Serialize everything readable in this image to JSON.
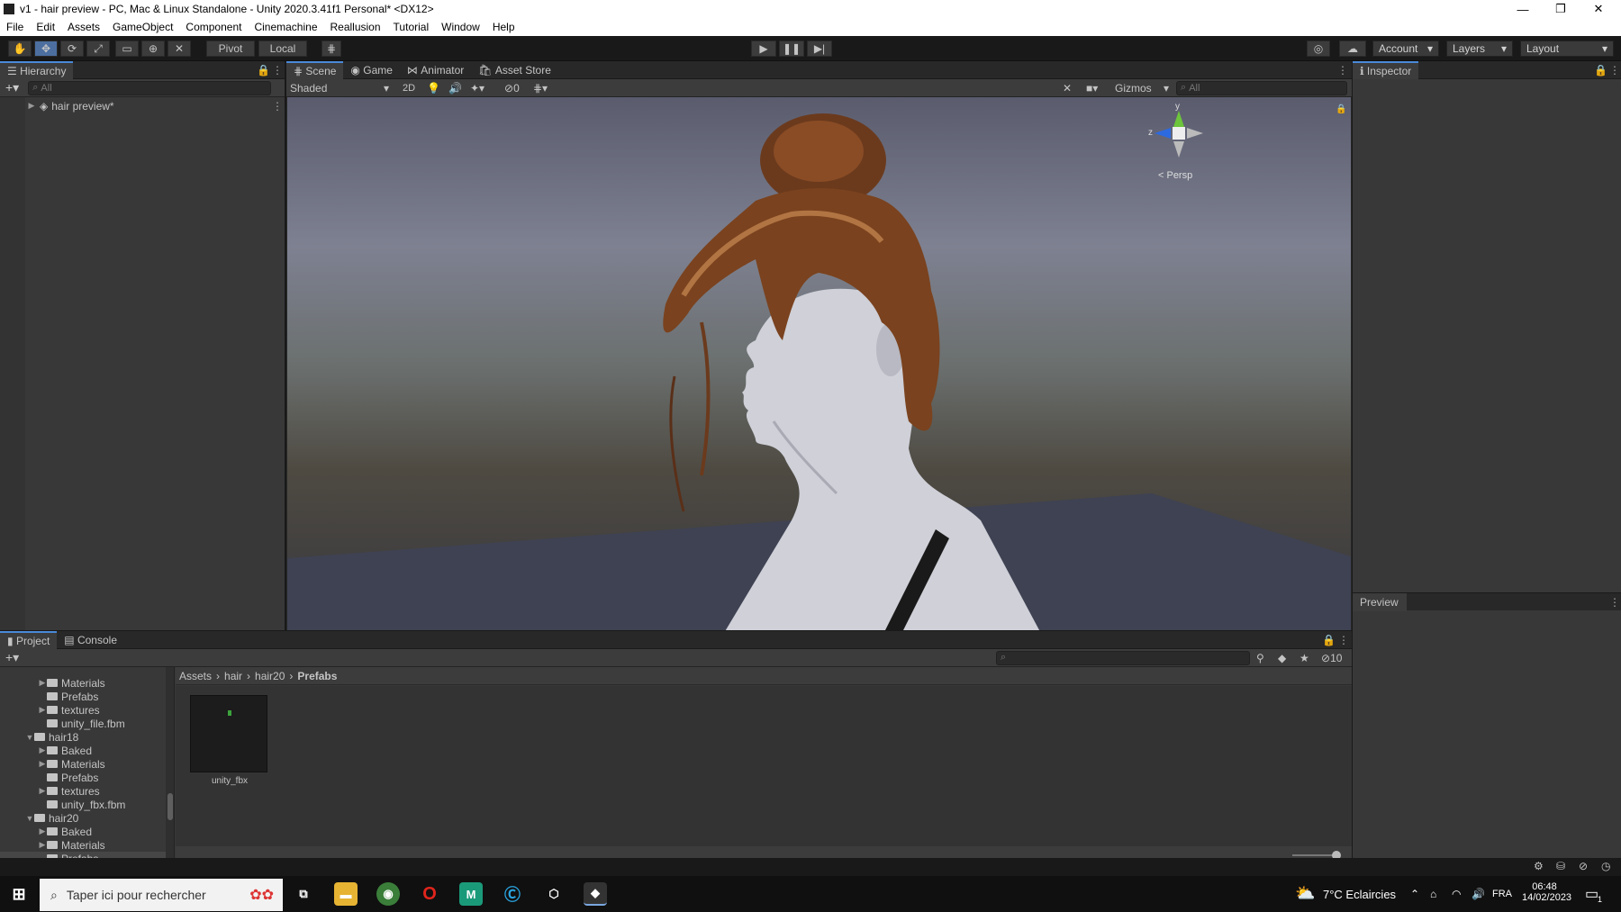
{
  "window": {
    "title": "v1 - hair preview - PC, Mac & Linux Standalone - Unity 2020.3.41f1 Personal* <DX12>"
  },
  "menu": [
    "File",
    "Edit",
    "Assets",
    "GameObject",
    "Component",
    "Cinemachine",
    "Reallusion",
    "Tutorial",
    "Window",
    "Help"
  ],
  "toolbar": {
    "pivot": "Pivot",
    "local": "Local",
    "account": "Account",
    "layers": "Layers",
    "layout": "Layout"
  },
  "hierarchy": {
    "title": "Hierarchy",
    "search_placeholder": "All",
    "scene_item": "hair preview*"
  },
  "scene_tabs": [
    "Scene",
    "Game",
    "Animator",
    "Asset Store"
  ],
  "scene_bar": {
    "shading": "Shaded",
    "mode2d": "2D",
    "hidden_count": "0",
    "gizmos": "Gizmos",
    "search_placeholder": "All"
  },
  "gizmo": {
    "y": "y",
    "z": "z",
    "persp": "< Persp"
  },
  "inspector": {
    "title": "Inspector",
    "preview": "Preview"
  },
  "project": {
    "tabs": [
      "Project",
      "Console"
    ],
    "hidden_count": "10",
    "breadcrumb": [
      "Assets",
      "hair",
      "hair20",
      "Prefabs"
    ],
    "tree": [
      {
        "label": "Materials",
        "arrow": "▶",
        "icon": true
      },
      {
        "label": "Prefabs",
        "arrow": "",
        "icon": true
      },
      {
        "label": "textures",
        "arrow": "▶",
        "icon": true
      },
      {
        "label": "unity_file.fbm",
        "arrow": "",
        "icon": true
      },
      {
        "label": "hair18",
        "arrow": "▼",
        "icon": true,
        "top": true
      },
      {
        "label": "Baked",
        "arrow": "▶",
        "icon": true
      },
      {
        "label": "Materials",
        "arrow": "▶",
        "icon": true
      },
      {
        "label": "Prefabs",
        "arrow": "",
        "icon": true
      },
      {
        "label": "textures",
        "arrow": "▶",
        "icon": true
      },
      {
        "label": "unity_fbx.fbm",
        "arrow": "",
        "icon": true
      },
      {
        "label": "hair20",
        "arrow": "▼",
        "icon": true,
        "top": true
      },
      {
        "label": "Baked",
        "arrow": "▶",
        "icon": true
      },
      {
        "label": "Materials",
        "arrow": "▶",
        "icon": true
      },
      {
        "label": "Prefabs",
        "arrow": "",
        "icon": true,
        "selected": true
      }
    ],
    "asset": {
      "name": "unity_fbx"
    }
  },
  "taskbar": {
    "search_placeholder": "Taper ici pour rechercher",
    "weather": "7°C  Eclaircies",
    "lang": "FRA",
    "time": "06:48",
    "date": "14/02/2023",
    "notif_count": "1"
  }
}
